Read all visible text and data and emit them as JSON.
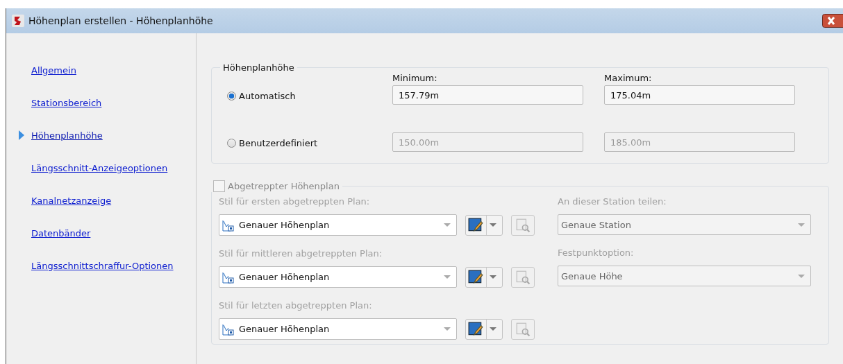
{
  "window": {
    "title": "Höhenplan erstellen - Höhenplanhöhe"
  },
  "nav": [
    {
      "label": "Allgemein",
      "selected": false
    },
    {
      "label": "Stationsbereich",
      "selected": false
    },
    {
      "label": "Höhenplanhöhe",
      "selected": true
    },
    {
      "label": "Längsschnitt-Anzeigeoptionen",
      "selected": false
    },
    {
      "label": "Kanalnetzanzeige",
      "selected": false
    },
    {
      "label": "Datenbänder",
      "selected": false
    },
    {
      "label": "Längsschnittschraffur-Optionen",
      "selected": false
    }
  ],
  "height_group": {
    "legend": "Höhenplanhöhe",
    "min_label": "Minimum:",
    "max_label": "Maximum:",
    "options": [
      {
        "label": "Automatisch",
        "selected": true,
        "min": "157.79m",
        "max": "175.04m"
      },
      {
        "label": "Benutzerdefiniert",
        "selected": false,
        "min": "150.00m",
        "max": "185.00m"
      }
    ]
  },
  "staggered_group": {
    "label": "Abgetreppter Höhenplan",
    "checked": false,
    "styles": [
      {
        "label": "Stil für ersten abgetreppten Plan:",
        "value": "Genauer Höhenplan"
      },
      {
        "label": "Stil für mittleren abgetreppten Plan:",
        "value": "Genauer Höhenplan"
      },
      {
        "label": "Stil für letzten abgetreppten Plan:",
        "value": "Genauer Höhenplan"
      }
    ],
    "options": [
      {
        "label": "An dieser Station teilen:",
        "value": "Genaue Station"
      },
      {
        "label": "Festpunktoption:",
        "value": "Genaue Höhe"
      }
    ]
  }
}
